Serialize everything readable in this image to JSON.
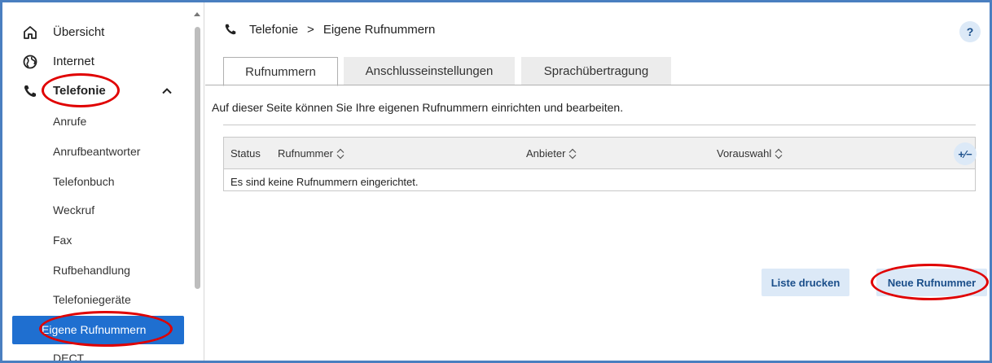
{
  "sidebar": {
    "items": [
      {
        "label": "Übersicht",
        "icon": "home-icon"
      },
      {
        "label": "Internet",
        "icon": "globe-icon"
      },
      {
        "label": "Telefonie",
        "icon": "phone-icon"
      }
    ],
    "subitems": [
      {
        "label": "Anrufe"
      },
      {
        "label": "Anrufbeantworter"
      },
      {
        "label": "Telefonbuch"
      },
      {
        "label": "Weckruf"
      },
      {
        "label": "Fax"
      },
      {
        "label": "Rufbehandlung"
      },
      {
        "label": "Telefoniegeräte"
      },
      {
        "label": "Eigene Rufnummern"
      },
      {
        "label": "DECT"
      }
    ],
    "active_label": "Eigene Rufnummern"
  },
  "breadcrumb": {
    "parent": "Telefonie",
    "separator": ">",
    "current": "Eigene Rufnummern"
  },
  "help_label": "?",
  "tabs": [
    {
      "label": "Rufnummern",
      "active": true
    },
    {
      "label": "Anschlusseinstellungen",
      "active": false
    },
    {
      "label": "Sprachübertragung",
      "active": false
    }
  ],
  "description": "Auf dieser Seite können Sie Ihre eigenen Rufnummern einrichten und bearbeiten.",
  "table": {
    "columns": [
      {
        "label": "Status",
        "sortable": false
      },
      {
        "label": "Rufnummer",
        "sortable": true
      },
      {
        "label": "Anbieter",
        "sortable": true
      },
      {
        "label": "Vorauswahl",
        "sortable": true
      }
    ],
    "column_toggle_label": "+⁄−",
    "empty_message": "Es sind keine Rufnummern eingerichtet."
  },
  "buttons": {
    "print": "Liste drucken",
    "new": "Neue Rufnummer"
  },
  "colors": {
    "accent": "#1f6fd0",
    "button_bg": "#dce9f7",
    "button_text": "#1a4e8a",
    "annotation": "#e00000"
  }
}
